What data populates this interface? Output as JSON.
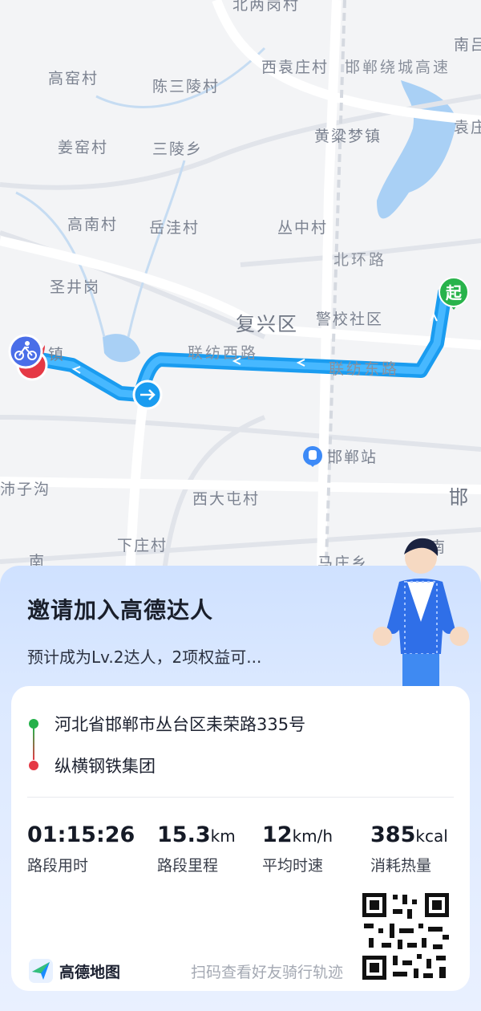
{
  "map": {
    "places": {
      "beiliang": "北两岗村",
      "nanjiao": "南吕",
      "gaoyao": "高窑村",
      "xiyuanzhuang": "西袁庄村",
      "chensanling": "陈三陵村",
      "expressway": "邯郸绕城高速",
      "yuanzhuang_right": "袁庄",
      "jiangyao": "姜窑村",
      "sanling": "三陵乡",
      "huangliang": "黄粱梦镇",
      "gaonan": "高南村",
      "yuewa": "岳洼村",
      "congzhong": "丛中村",
      "beihuan": "北环路",
      "shengjinggang": "圣井岗",
      "fuxing": "复兴区",
      "jingxiao": "警校社区",
      "lianfang_west": "联纺西路",
      "lianfang_east": "联纺东路",
      "left_town": "镇",
      "handan_station": "邯郸站",
      "shizigou": "沛子沟",
      "xidatun": "西大屯村",
      "han_city": "邯",
      "xiazhuang": "下庄村",
      "mazhuang": "马庄乡",
      "nanhe_left": "南",
      "nan_right": "南"
    },
    "start_marker": "起",
    "colors": {
      "route": "#1a9cf0",
      "route_inner": "#47b8ff",
      "start": "#28b34b",
      "end": "#e53945"
    },
    "icons": [
      "bike-icon",
      "direction-arrow-icon",
      "train-station-icon"
    ]
  },
  "invite": {
    "title": "邀请加入高德达人",
    "subtitle": "预计成为Lv.2达人，2项权益可..."
  },
  "route": {
    "origin": "河北省邯郸市丛台区耒荣路335号",
    "destination": "纵横钢铁集团"
  },
  "stats": [
    {
      "value": "01:15:26",
      "unit": "",
      "label": "路段用时"
    },
    {
      "value": "15.3",
      "unit": "km",
      "label": "路段里程"
    },
    {
      "value": "12",
      "unit": "km/h",
      "label": "平均时速"
    },
    {
      "value": "385",
      "unit": "kcal",
      "label": "消耗热量"
    }
  ],
  "brand": {
    "name": "高德地图"
  },
  "scan_hint": "扫码查看好友骑行轨迹"
}
